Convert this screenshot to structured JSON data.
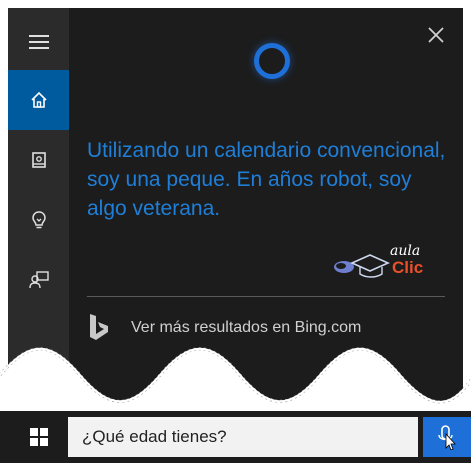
{
  "colors": {
    "accent": "#005a9e",
    "cortana_blue": "#1f7fd8",
    "panel_bg": "#1c1c1c",
    "rail_bg": "#2b2b2b",
    "logo_orange": "#e8502a"
  },
  "rail": {
    "items": [
      {
        "icon": "menu-icon"
      },
      {
        "icon": "home-icon",
        "active": true
      },
      {
        "icon": "notebook-icon"
      },
      {
        "icon": "lightbulb-icon"
      },
      {
        "icon": "feedback-icon"
      }
    ]
  },
  "answer": {
    "text": "Utilizando un calendario convencional, soy una peque. En años robot, soy algo veterana."
  },
  "logo": {
    "line1": "aula",
    "line2": "Clic"
  },
  "bing": {
    "link_text": "Ver más resultados en Bing.com"
  },
  "search": {
    "query": "¿Qué edad tienes?"
  }
}
